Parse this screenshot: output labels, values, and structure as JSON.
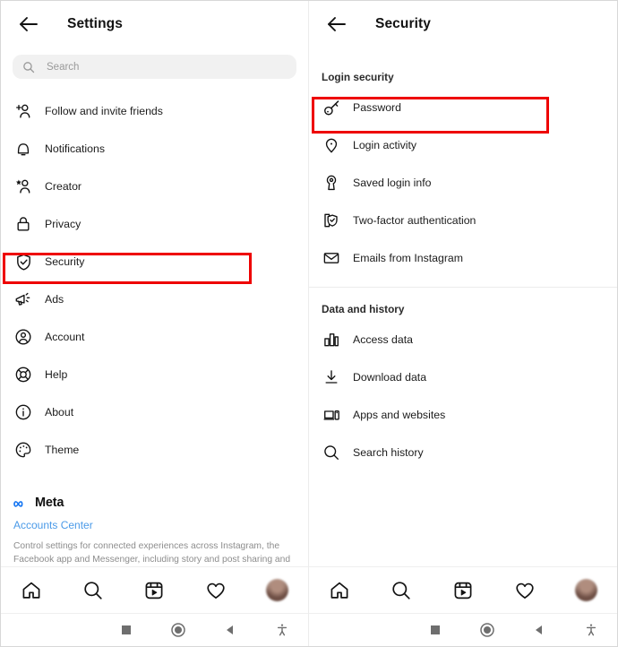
{
  "app": "Instagram",
  "panels": {
    "left": {
      "header": {
        "title": "Settings",
        "back_icon": "back-arrow-icon"
      },
      "search": {
        "placeholder": "Search",
        "icon": "search-icon"
      },
      "items": [
        {
          "label": "Follow and invite friends",
          "icon": "person-add-icon"
        },
        {
          "label": "Notifications",
          "icon": "bell-icon"
        },
        {
          "label": "Creator",
          "icon": "person-star-icon"
        },
        {
          "label": "Privacy",
          "icon": "lock-icon"
        },
        {
          "label": "Security",
          "icon": "shield-check-icon",
          "highlighted": true
        },
        {
          "label": "Ads",
          "icon": "megaphone-icon"
        },
        {
          "label": "Account",
          "icon": "account-circle-icon"
        },
        {
          "label": "Help",
          "icon": "lifebuoy-icon"
        },
        {
          "label": "About",
          "icon": "info-circle-icon"
        },
        {
          "label": "Theme",
          "icon": "palette-icon"
        }
      ],
      "footer": {
        "brand": "Meta",
        "brand_icon": "meta-infinity-icon",
        "link": "Accounts Center",
        "link_color": "#4a9ae8",
        "description": "Control settings for connected experiences across Instagram, the Facebook app and Messenger, including story and post sharing and"
      }
    },
    "right": {
      "header": {
        "title": "Security",
        "back_icon": "back-arrow-icon"
      },
      "sections": [
        {
          "title": "Login security",
          "items": [
            {
              "label": "Password",
              "icon": "key-icon",
              "highlighted": true
            },
            {
              "label": "Login activity",
              "icon": "location-pin-icon"
            },
            {
              "label": "Saved login info",
              "icon": "keyhole-icon"
            },
            {
              "label": "Two-factor authentication",
              "icon": "shield-check-card-icon"
            },
            {
              "label": "Emails from Instagram",
              "icon": "envelope-icon"
            }
          ]
        },
        {
          "title": "Data and history",
          "items": [
            {
              "label": "Access data",
              "icon": "bar-chart-icon"
            },
            {
              "label": "Download data",
              "icon": "download-icon"
            },
            {
              "label": "Apps and websites",
              "icon": "laptop-phone-icon"
            },
            {
              "label": "Search history",
              "icon": "search-icon"
            }
          ]
        }
      ]
    }
  },
  "tabbar": {
    "items": [
      {
        "name": "home",
        "icon": "home-icon"
      },
      {
        "name": "search",
        "icon": "search-icon"
      },
      {
        "name": "reels",
        "icon": "reels-icon"
      },
      {
        "name": "activity",
        "icon": "heart-icon"
      },
      {
        "name": "profile",
        "icon": "avatar-icon"
      }
    ]
  },
  "navbar": {
    "items": [
      {
        "name": "recents",
        "icon": "square-icon"
      },
      {
        "name": "home",
        "icon": "circle-icon"
      },
      {
        "name": "back",
        "icon": "triangle-back-icon"
      },
      {
        "name": "accessibility",
        "icon": "accessibility-icon"
      }
    ]
  },
  "highlights": {
    "color": "#ee0000",
    "targets": [
      "Security",
      "Password"
    ]
  }
}
